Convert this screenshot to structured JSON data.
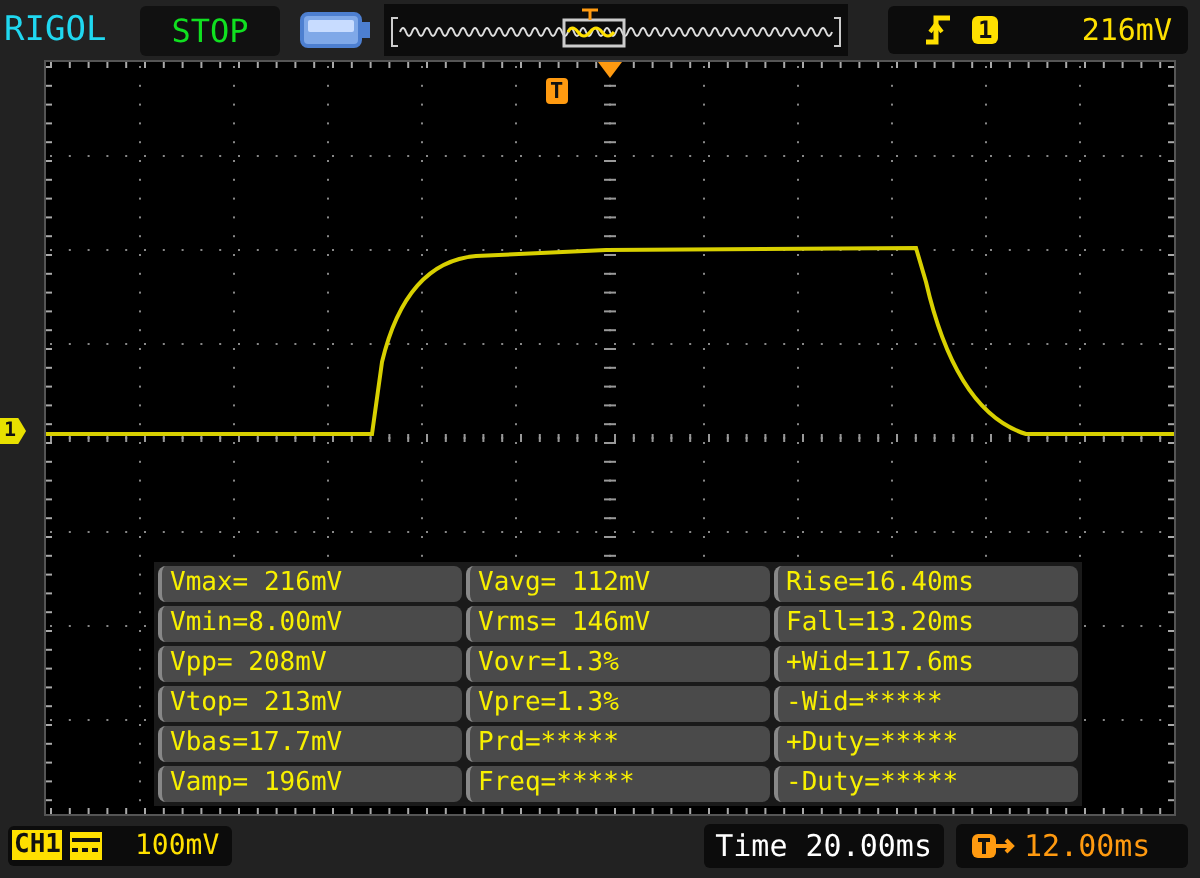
{
  "header": {
    "brand": "RIGOL",
    "run_state": "STOP",
    "trigger": {
      "source": "1",
      "level": "216mV"
    }
  },
  "screen": {
    "channel_marker": "1",
    "trigger_marker": "T"
  },
  "measurements": [
    {
      "cells": [
        "Vmax= 216mV",
        "Vavg= 112mV",
        "Rise=16.40ms"
      ]
    },
    {
      "cells": [
        "Vmin=8.00mV",
        "Vrms= 146mV",
        "Fall=13.20ms"
      ]
    },
    {
      "cells": [
        "Vpp= 208mV",
        "Vovr=1.3%",
        "+Wid=117.6ms"
      ]
    },
    {
      "cells": [
        "Vtop= 213mV",
        "Vpre=1.3%",
        "-Wid=*****"
      ]
    },
    {
      "cells": [
        "Vbas=17.7mV",
        "Prd=*****",
        "+Duty=*****"
      ]
    },
    {
      "cells": [
        "Vamp= 196mV",
        "Freq=*****",
        "-Duty=*****"
      ]
    }
  ],
  "footer": {
    "channel": "CH1",
    "scale": "100mV",
    "timebase": "Time 20.00ms",
    "trigger_offset": "12.00ms"
  }
}
